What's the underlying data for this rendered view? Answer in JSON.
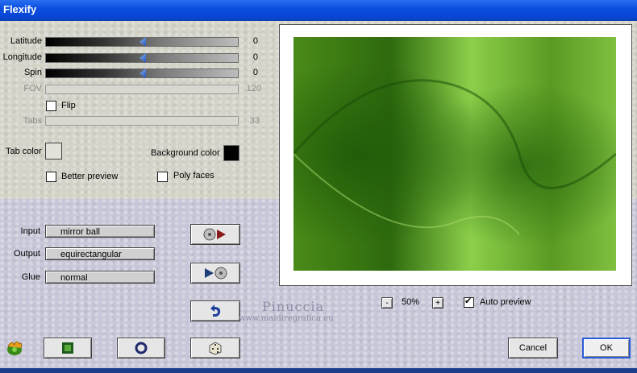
{
  "window": {
    "title": "Flexify"
  },
  "params": [
    {
      "label": "Latitude",
      "value": "0"
    },
    {
      "label": "Longitude",
      "value": "0"
    },
    {
      "label": "Spin",
      "value": "0"
    },
    {
      "label": "FOV",
      "value": "120"
    }
  ],
  "flip": {
    "label": "Flip",
    "checked": false
  },
  "tabs": {
    "label": "Tabs",
    "value": "33"
  },
  "tab_color": {
    "label": "Tab color",
    "color": "#d4d3c8"
  },
  "background_color": {
    "label": "Background color",
    "color": "#000000"
  },
  "better_preview": {
    "label": "Better preview",
    "checked": false
  },
  "poly_faces": {
    "label": "Poly faces",
    "checked": false
  },
  "mapping": {
    "input": {
      "label": "Input",
      "value": "mirror ball"
    },
    "output": {
      "label": "Output",
      "value": "equirectangular"
    },
    "glue": {
      "label": "Glue",
      "value": "normal"
    }
  },
  "zoom": {
    "minus": "-",
    "value": "50%",
    "plus": "+"
  },
  "auto_preview": {
    "label": "Auto preview",
    "checked": true
  },
  "watermark": {
    "name": "Pinuccia",
    "url": "www.maidiregrafica.eu"
  },
  "buttons": {
    "cancel": "Cancel",
    "ok": "OK"
  },
  "colors": {
    "preview_green": "#5e9a1e",
    "accent": "#0a4ee0"
  }
}
